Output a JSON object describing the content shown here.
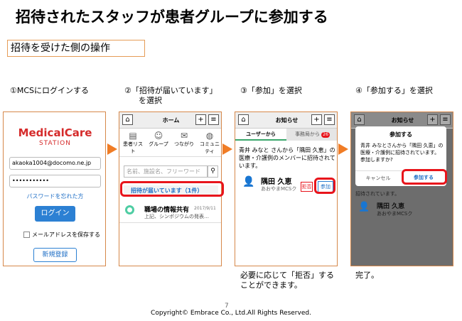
{
  "title": "招待されたスタッフが患者グループに参加する",
  "subtitle": "招待を受けた側の操作",
  "steps": [
    {
      "label": "①MCSにログインする"
    },
    {
      "label_line1": "②「招待が届いています」",
      "label_line2": "を選択"
    },
    {
      "label": "③「参加」を選択"
    },
    {
      "label": "④「参加する」を選択"
    }
  ],
  "login": {
    "logo_main": "MedicalCare",
    "logo_sub": "STATION",
    "email_value": "akaoka1004@docomo.ne.jp",
    "password_value": "•••••••••••",
    "forgot_link": "パスワードを忘れた方",
    "login_button": "ログイン",
    "remember_label": "メールアドレスを保存する",
    "register_button": "新規登録"
  },
  "home": {
    "header_title": "ホーム",
    "tabs": [
      "患者リスト",
      "グループ",
      "つながり",
      "コミュニティ"
    ],
    "search_placeholder": "名前、施設名、フリーワード",
    "invite_banner": "招待が届いています（1件）",
    "news_title": "職場の情報共有",
    "news_date": "2017/9/11",
    "news_body": "上記、シンポジウムの発表…"
  },
  "notice": {
    "header_title": "お知らせ",
    "tab_user": "ユーザーから",
    "tab_office": "事務局から",
    "office_badge": "26",
    "message": "青井 みなと さんから「隅田 久恵」の医療・介護例のメンバーに招待されています。",
    "patient_name": "隅田 久恵",
    "patient_sub": "あおやまMCSク",
    "reject_button": "拒否",
    "join_button": "参加"
  },
  "dialog": {
    "header_title": "お知らせ",
    "title": "参加する",
    "message": "青井 みなとさんから「隅田 久恵」の医療・介護例に招待されています。参加しますか?",
    "cancel_button": "キャンセル",
    "confirm_button": "参加する",
    "bg_text": "招待されています。",
    "bg_patient": "隅田 久恵",
    "bg_patient_sub": "あおやまMCSク"
  },
  "notes": {
    "step3_line1": "必要に応じて「拒否」する",
    "step3_line2": "ことができます。",
    "step4": "完了。"
  },
  "footer": {
    "page_number": "7",
    "copyright": "Copyright© Embrace Co., Ltd.All Rights Reserved."
  },
  "colors": {
    "accent": "#f07c25",
    "highlight": "#e8141b",
    "brand_blue": "#1f6fc6",
    "logo_red": "#d52b2b",
    "green": "#3aa66b"
  }
}
